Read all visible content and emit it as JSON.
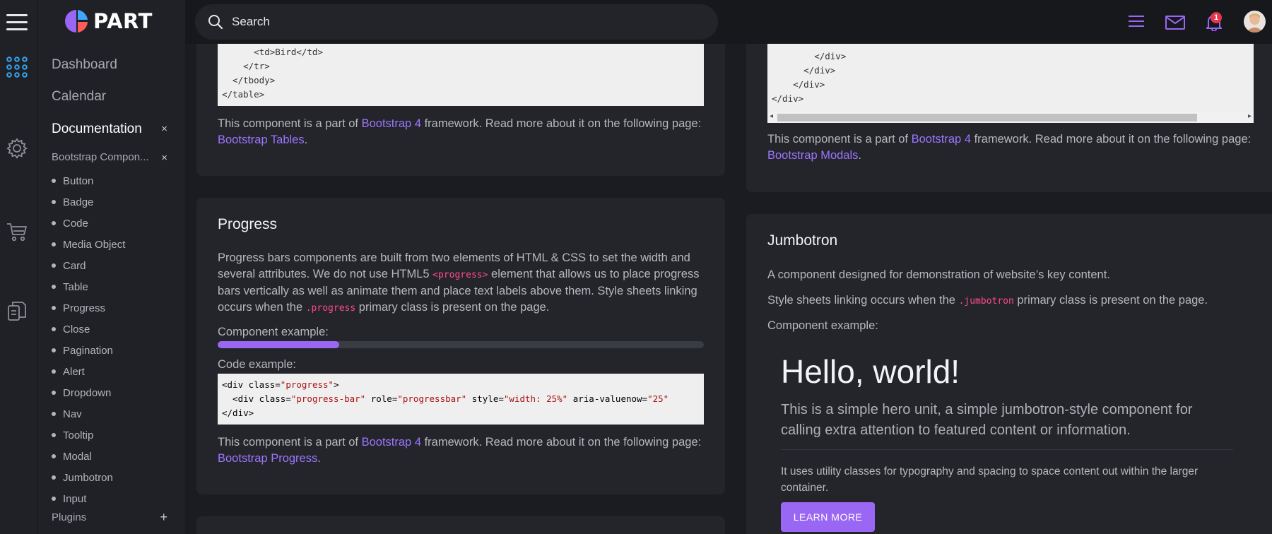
{
  "brand": {
    "name": "PART"
  },
  "sidebar": {
    "nav": [
      "Dashboard",
      "Calendar",
      "Documentation"
    ],
    "doc_close": "×",
    "sub_head": "Bootstrap Compon...",
    "sub_close": "×",
    "items": [
      "Button",
      "Badge",
      "Code",
      "Media Object",
      "Card",
      "Table",
      "Progress",
      "Close",
      "Pagination",
      "Alert",
      "Dropdown",
      "Nav",
      "Tooltip",
      "Modal",
      "Jumbotron",
      "Input"
    ],
    "plugins": "Plugins",
    "plugins_add": "+"
  },
  "topbar": {
    "search_placeholder": "Search",
    "notif_count": "1"
  },
  "table_card": {
    "code": [
      "      <td>Bird</td>",
      "    </tr>",
      "  </tbody>",
      "</table>"
    ],
    "text_pre": "This component is a part of ",
    "link1": "Bootstrap 4",
    "text_mid": " framework. Read more about it on the following page: ",
    "link2": "Bootstrap Tables",
    "text_end": "."
  },
  "progress_card": {
    "title": "Progress",
    "desc_1": "Progress bars components are built from two elements of HTML & CSS to set the width and several attributes. We do not use HTML5 ",
    "desc_code1": "<progress>",
    "desc_2": " element that allows us to place progress bars vertically as well as animate them and place text labels above them. Style sheets linking occurs when the ",
    "desc_code2": ".progress",
    "desc_3": " primary class is present on the page.",
    "example_label": "Component example:",
    "progress_value": 25,
    "code_label": "Code example:",
    "code": [
      {
        "pre": "<div class=",
        "val": "\"progress\"",
        "post": ">"
      },
      {
        "pre": "  <div class=",
        "val": "\"progress-bar\"",
        "post": " role=",
        "val2": "\"progressbar\"",
        "post2": " style=",
        "val3": "\"width: 25%\"",
        "post3": " aria-valuenow=",
        "val4": "\"25\""
      },
      {
        "pre": "</div>"
      }
    ],
    "text_pre": "This component is a part of ",
    "link1": "Bootstrap 4",
    "text_mid": " framework. Read more about it on the following page: ",
    "link2": "Bootstrap Progress",
    "text_end": "."
  },
  "modal_card": {
    "code": [
      "        </div>",
      "      </div>",
      "    </div>",
      "</div>"
    ],
    "text_pre": "This component is a part of ",
    "link1": "Bootstrap 4",
    "text_mid": " framework. Read more about it on the following page: ",
    "link2": "Bootstrap Modals",
    "text_end": "."
  },
  "jumbotron_card": {
    "title": "Jumbotron",
    "desc": "A component designed for demonstration of website’s key content.",
    "style_pre": "Style sheets linking occurs when the ",
    "style_code": ".jumbotron",
    "style_post": " primary class is present on the page.",
    "example_label": "Component example:",
    "hero_title": "Hello, world!",
    "hero_lead": "This is a simple hero unit, a simple jumbotron-style component for calling extra attention to featured content or information.",
    "hero_text": "It uses utility classes for typography and spacing to space content out within the larger container.",
    "button": "LEARN MORE"
  },
  "colors": {
    "accent": "#9a67f5",
    "link": "#9f75ff",
    "inline_code": "#ff4b8b",
    "badge": "#e5364c"
  }
}
